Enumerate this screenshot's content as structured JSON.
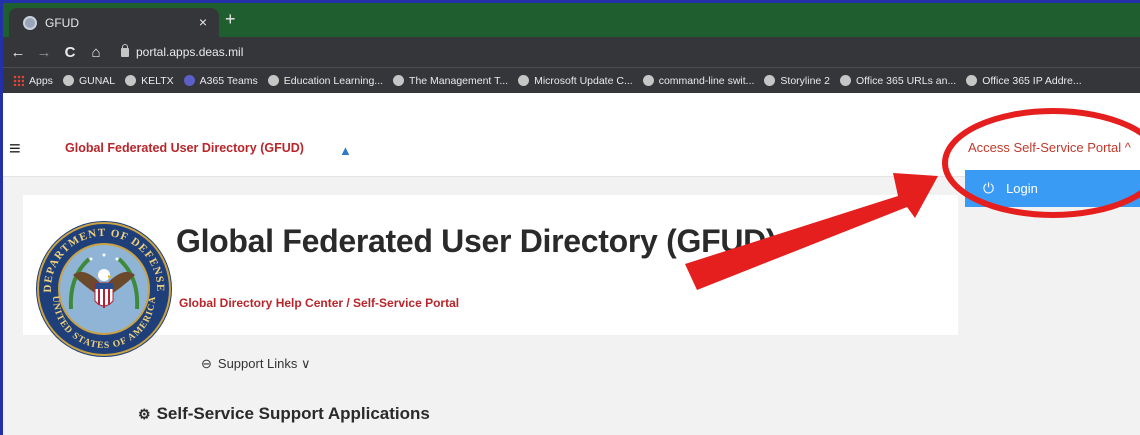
{
  "browser": {
    "tab_title": "GFUD",
    "tab_close": "×",
    "new_tab": "+",
    "nav_back": "←",
    "nav_forward": "→",
    "nav_reload": "C",
    "nav_home": "⌂",
    "url": "portal.apps.deas.mil",
    "bookmarks": [
      "Apps",
      "GUNAL",
      "KELTX",
      "A365 Teams",
      "Education Learning...",
      "The Management T...",
      "Microsoft Update C...",
      "command-line swit...",
      "Storyline 2",
      "Office 365 URLs an...",
      "Office 365 IP Addre..."
    ]
  },
  "header": {
    "menu_icon": "≡",
    "site_title": "Global Federated User Directory (GFUD)",
    "home_icon": "▲",
    "access_portal": "Access Self-Service Portal ^"
  },
  "dropdown": {
    "power_icon": "⏻",
    "login": "Login"
  },
  "main": {
    "title": "Global Federated User Directory (GFUD)",
    "subtitle": "Global Directory Help Center / Self-Service Portal",
    "support_links": "Support Links ∨",
    "section_heading": "Self-Service Support Applications"
  },
  "seal_text": {
    "top": "DEPARTMENT OF DEFENSE",
    "bottom": "UNITED STATES OF AMERICA"
  },
  "colors": {
    "tab_bar": "#1f5e2e",
    "browser_chrome": "#35363a",
    "accent_red": "#b8262b",
    "dropdown_blue": "#3a9bf4",
    "annotation_red": "#e51e1e",
    "frame_blue": "#2330a8"
  }
}
